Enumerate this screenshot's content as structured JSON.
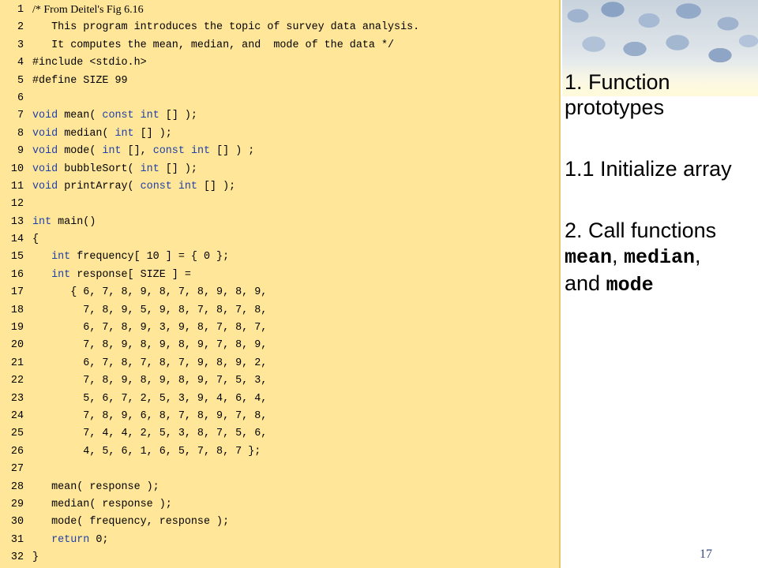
{
  "code": {
    "lines": [
      {
        "n": "1",
        "text": "/* From Deitel's Fig 6.16"
      },
      {
        "n": "2",
        "text": "   This program introduces the topic of survey data analysis."
      },
      {
        "n": "3",
        "text": "   It computes the mean, median, and  mode of the data */"
      },
      {
        "n": "4",
        "text": "#include <stdio.h>"
      },
      {
        "n": "5",
        "text": "#define SIZE 99"
      },
      {
        "n": "6",
        "text": ""
      },
      {
        "n": "7",
        "text": "void mean( const int [] );"
      },
      {
        "n": "8",
        "text": "void median( int [] );"
      },
      {
        "n": "9",
        "text": "void mode( int [], const int [] ) ;"
      },
      {
        "n": "10",
        "text": "void bubbleSort( int [] );"
      },
      {
        "n": "11",
        "text": "void printArray( const int [] );"
      },
      {
        "n": "12",
        "text": ""
      },
      {
        "n": "13",
        "text": "int main()"
      },
      {
        "n": "14",
        "text": "{"
      },
      {
        "n": "15",
        "text": "   int frequency[ 10 ] = { 0 };"
      },
      {
        "n": "16",
        "text": "   int response[ SIZE ] ="
      },
      {
        "n": "17",
        "text": "      { 6, 7, 8, 9, 8, 7, 8, 9, 8, 9,"
      },
      {
        "n": "18",
        "text": "        7, 8, 9, 5, 9, 8, 7, 8, 7, 8,"
      },
      {
        "n": "19",
        "text": "        6, 7, 8, 9, 3, 9, 8, 7, 8, 7,"
      },
      {
        "n": "20",
        "text": "        7, 8, 9, 8, 9, 8, 9, 7, 8, 9,"
      },
      {
        "n": "21",
        "text": "        6, 7, 8, 7, 8, 7, 9, 8, 9, 2,"
      },
      {
        "n": "22",
        "text": "        7, 8, 9, 8, 9, 8, 9, 7, 5, 3,"
      },
      {
        "n": "23",
        "text": "        5, 6, 7, 2, 5, 3, 9, 4, 6, 4,"
      },
      {
        "n": "24",
        "text": "        7, 8, 9, 6, 8, 7, 8, 9, 7, 8,"
      },
      {
        "n": "25",
        "text": "        7, 4, 4, 2, 5, 3, 8, 7, 5, 6,"
      },
      {
        "n": "26",
        "text": "        4, 5, 6, 1, 6, 5, 7, 8, 7 };"
      },
      {
        "n": "27",
        "text": ""
      },
      {
        "n": "28",
        "text": "   mean( response );"
      },
      {
        "n": "29",
        "text": "   median( response );"
      },
      {
        "n": "30",
        "text": "   mode( frequency, response );"
      },
      {
        "n": "31",
        "text": "   return 0;"
      },
      {
        "n": "32",
        "text": "}"
      }
    ]
  },
  "outline": {
    "item1": "1.  Function prototypes",
    "item2": "1.1  Initialize array",
    "item3_prefix": "2.  Call functions ",
    "item3_mean": "mean",
    "item3_sep1": ", ",
    "item3_median": "median",
    "item3_sep2": ",",
    "item3_and": "and ",
    "item3_mode": "mode"
  },
  "page_number": "17",
  "colors": {
    "code_background": "#ffe699",
    "keyword": "#1f3fa8",
    "page_number": "#3a4a8a"
  }
}
